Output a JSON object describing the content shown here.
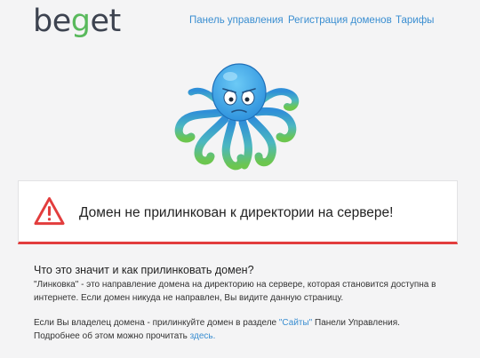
{
  "header": {
    "logo": {
      "prefix": "be",
      "g": "g",
      "suffix": "et"
    },
    "nav": [
      "Панель управления",
      "Регистрация доменов",
      "Тарифы"
    ]
  },
  "error": {
    "message": "Домен не прилинкован к директории на сервере!"
  },
  "help": {
    "title": "Что это значит и как прилинковать домен?",
    "p1_a": "\"Линковка\"",
    "p1_b": " - это направление домена на директорию на сервере, которая становится доступна в интернете. Если домен никуда не направлен, Вы видите данную страницу.",
    "p2_a": "Если Вы владелец домена - прилинкуйте домен в разделе ",
    "p2_link": "\"Сайты\"",
    "p2_b": " Панели Управления.",
    "p3_a": "Подробнее об этом можно прочитать ",
    "p3_link": "здесь."
  },
  "colors": {
    "link": "#3a8ed1",
    "logo_dark": "#3d4350",
    "logo_green": "#59b95c",
    "error_red": "#e23d3d",
    "octopus_blue": "#3ba5e6",
    "tentacle_green": "#5fc15a"
  },
  "icons": [
    "warning-icon",
    "octopus-mascot"
  ]
}
